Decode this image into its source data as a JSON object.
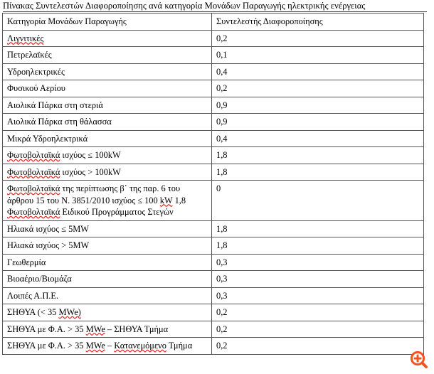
{
  "document": {
    "caption": "Πίνακας Συντελεστών Διαφοροποίησης  ανά κατηγορία Μονάδων Παραγωγής ηλεκτρικής  ενέργειας"
  },
  "table": {
    "headers": {
      "category": "Κατηγορία Μονάδων Παραγωγής",
      "coefficient": "Συντελεστής Διαφοροποίησης"
    },
    "rows": [
      {
        "category": "Λιγνιτικές",
        "coefficient": "0,2"
      },
      {
        "category": "Πετρελαϊκές",
        "coefficient": "0,1"
      },
      {
        "category": "Υδροηλεκτρικές",
        "coefficient": "0,4"
      },
      {
        "category": "Φυσικού Αερίου",
        "coefficient": "0,2"
      },
      {
        "category": "Αιολικά Πάρκα στη στεριά",
        "coefficient": "0,9"
      },
      {
        "category": "Αιολικά Πάρκα στη θάλασσα",
        "coefficient": "0,9"
      },
      {
        "category": "Μικρά Υδροηλεκτρικά",
        "coefficient": "0,4"
      },
      {
        "category": "Φωτοβολταϊκά ισχύος ≤ 100kW",
        "coefficient": "1,8"
      },
      {
        "category": "Φωτοβολταϊκά ισχύος > 100kW",
        "coefficient": "1,8"
      },
      {
        "category": "Φωτοβολταϊκά της περίπτωσης β΄ της παρ. 6 του άρθρου 15 του Ν. 3851/2010 ισχύος ≤ 100 kW 1,8 Φωτοβολταϊκά Ειδικού Προγράμματος Στεγών",
        "coefficient": "0"
      },
      {
        "category": "Ηλιακά ισχύος ≤ 5MW",
        "coefficient": "1,8"
      },
      {
        "category": "Ηλιακά ισχύος > 5MW",
        "coefficient": "1,8"
      },
      {
        "category": "Γεωθερμία",
        "coefficient": "0,3"
      },
      {
        "category": "Βιοαέριο/Βιομάζα",
        "coefficient": "0,3"
      },
      {
        "category": "Λοιπές Α.Π.Ε.",
        "coefficient": "0,3"
      },
      {
        "category": "ΣΗΘΥΑ (< 35 MWe)",
        "coefficient": "0,2"
      },
      {
        "category": "ΣΗΘΥΑ με Φ.Α. > 35 MWe – ΣΗΘΥΑ Τμήμα",
        "coefficient": "0,2"
      },
      {
        "category": "ΣΗΘΥΑ με Φ.Α. > 35 MWe – Κατανεμόμενο Τμήμα",
        "coefficient": "0,2"
      }
    ]
  },
  "overlay": {
    "zoom_icon_name": "zoom-in-icon",
    "zoom_icon_color": "#f4511e"
  }
}
